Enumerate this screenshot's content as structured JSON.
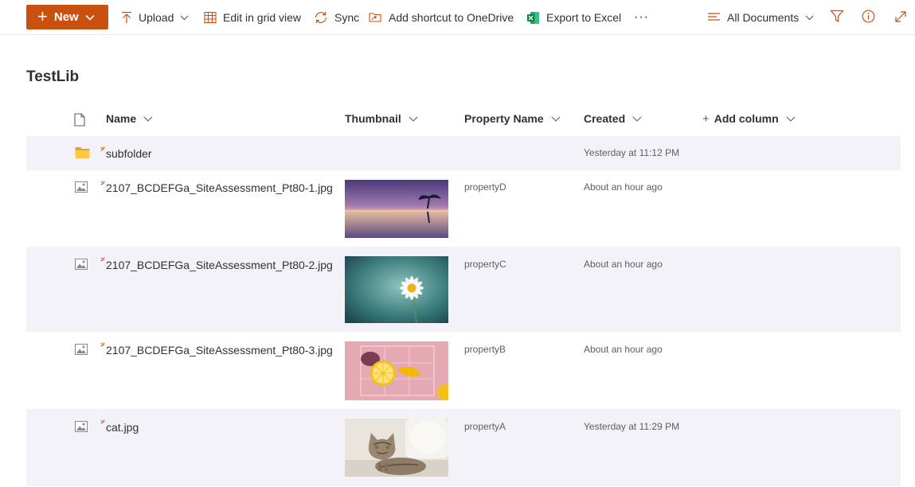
{
  "toolbar": {
    "new_label": "New",
    "upload_label": "Upload",
    "edit_grid_label": "Edit in grid view",
    "sync_label": "Sync",
    "shortcut_label": "Add shortcut to OneDrive",
    "export_label": "Export to Excel",
    "more_label": "···",
    "view_label": "All Documents"
  },
  "library": {
    "title": "TestLib"
  },
  "columns": {
    "name": "Name",
    "thumbnail": "Thumbnail",
    "property": "Property Name",
    "created": "Created",
    "add": "Add column",
    "add_plus": "+"
  },
  "rows": [
    {
      "name": "subfolder",
      "type": "folder-icon",
      "property": "",
      "created": "Yesterday at 11:12 PM"
    },
    {
      "name": "2107_BCDEFGa_SiteAssessment_Pt80-1.jpg",
      "type": "image-file-icon",
      "property": "propertyD",
      "created": "About an hour ago"
    },
    {
      "name": "2107_BCDEFGa_SiteAssessment_Pt80-2.jpg",
      "type": "image-file-icon",
      "property": "propertyC",
      "created": "About an hour ago"
    },
    {
      "name": "2107_BCDEFGa_SiteAssessment_Pt80-3.jpg",
      "type": "image-file-icon",
      "property": "propertyB",
      "created": "About an hour ago"
    },
    {
      "name": "cat.jpg",
      "type": "image-file-icon",
      "property": "propertyA",
      "created": "Yesterday at 11:29 PM"
    }
  ],
  "colors": {
    "accent": "#ca5010",
    "row_alt": "#f3f2f9",
    "text": "#323130",
    "muted": "#605e5c",
    "excel": "#107c41"
  }
}
